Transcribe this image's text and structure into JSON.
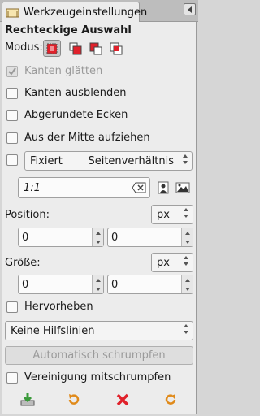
{
  "window": {
    "tab_title": "Werkzeugeinstellungen"
  },
  "tool": {
    "title": "Rechteckige Auswahl"
  },
  "modus": {
    "label": "Modus:"
  },
  "options": {
    "antialias": "Kanten glätten",
    "feather": "Kanten ausblenden",
    "rounded": "Abgerundete Ecken",
    "from_center": "Aus der Mitte aufziehen",
    "highlight": "Hervorheben",
    "shrink_merged": "Vereinigung mitschrumpfen"
  },
  "fixed": {
    "label": "Fixiert",
    "value": "Seitenverhältnis",
    "ratio": "1:1"
  },
  "position": {
    "label": "Position:",
    "unit": "px",
    "x": "0",
    "y": "0"
  },
  "size": {
    "label": "Größe:",
    "unit": "px",
    "w": "0",
    "h": "0"
  },
  "guides": {
    "value": "Keine Hilfslinien"
  },
  "shrink_button": "Automatisch schrumpfen",
  "colors": {
    "accent": "#e0212b",
    "save": "#3a9a3a",
    "reset": "#e08a1a"
  }
}
